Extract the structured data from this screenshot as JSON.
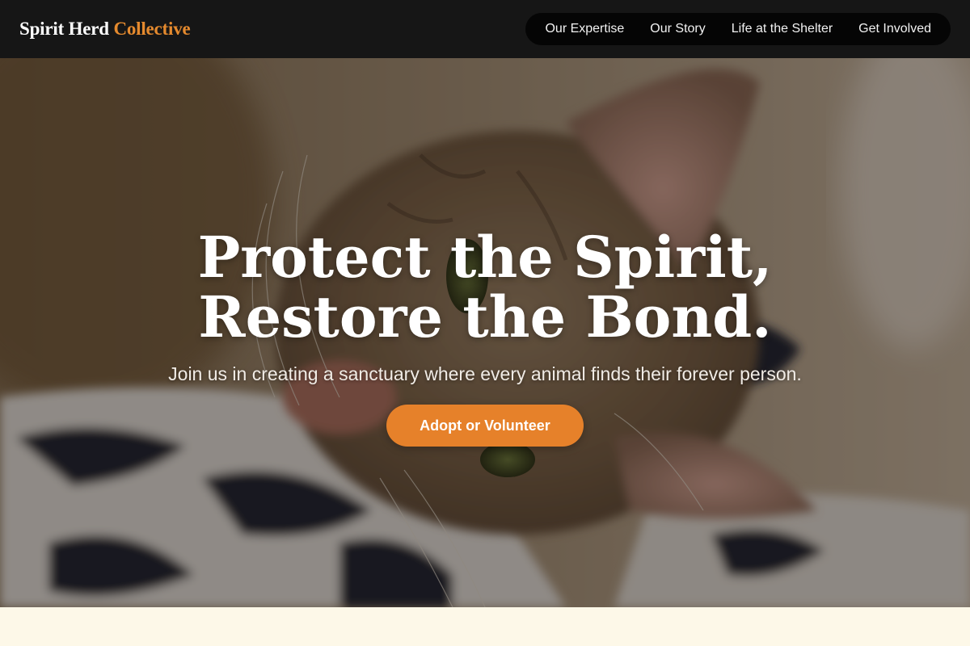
{
  "header": {
    "brand_main": "Spirit Herd",
    "brand_accent": "Collective",
    "nav": [
      {
        "label": "Our Expertise"
      },
      {
        "label": "Our Story"
      },
      {
        "label": "Life at the Shelter"
      },
      {
        "label": "Get Involved"
      }
    ]
  },
  "hero": {
    "title": "Protect the Spirit, Restore the Bond.",
    "subtitle": "Join us in creating a sanctuary where every animal finds their forever person.",
    "cta_label": "Adopt or Volunteer"
  },
  "colors": {
    "header_bg": "#161616",
    "nav_pill_bg": "#050505",
    "accent": "#e58a2e",
    "cta_bg": "#e6812a",
    "section_bg": "#fdf8e8"
  }
}
